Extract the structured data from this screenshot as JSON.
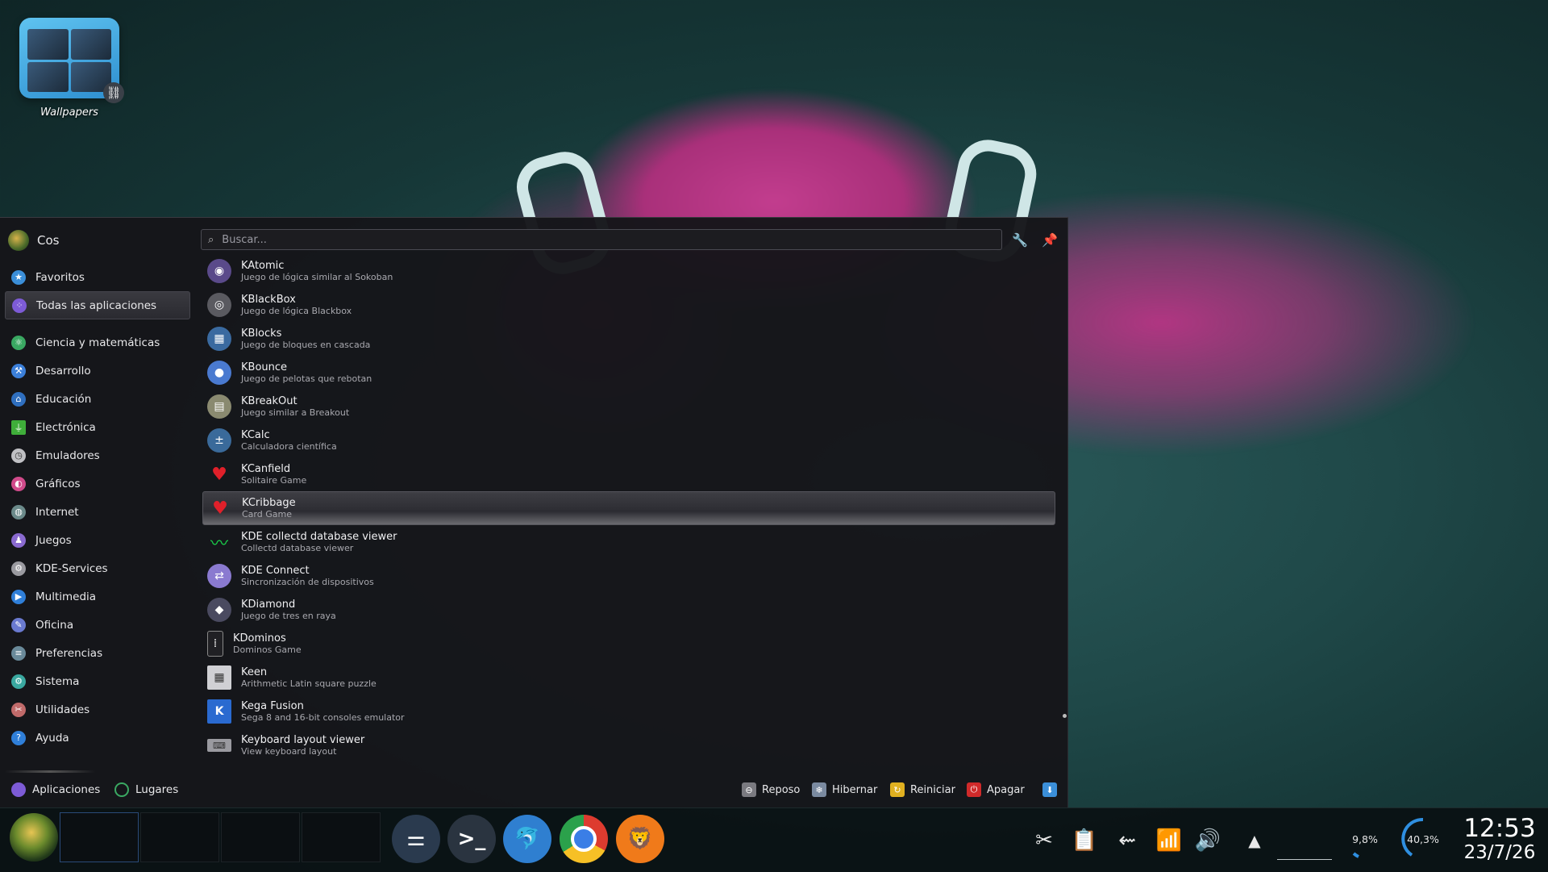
{
  "desktop": {
    "icons": [
      {
        "label": "Wallpapers",
        "icon": "folder-link-icon"
      }
    ]
  },
  "launcher": {
    "user": {
      "name": "Cos"
    },
    "search": {
      "placeholder": "Buscar..."
    },
    "categories": [
      {
        "label": "Favoritos",
        "icon": "star-icon",
        "color": "#3b8fd9"
      },
      {
        "label": "Todas las aplicaciones",
        "icon": "apps-icon",
        "color": "#7d5bd6",
        "selected": true
      },
      {
        "label": "Ciencia y matemáticas",
        "icon": "science-icon",
        "color": "#3aa862"
      },
      {
        "label": "Desarrollo",
        "icon": "development-icon",
        "color": "#3b7fd9"
      },
      {
        "label": "Educación",
        "icon": "education-icon",
        "color": "#2f6fbf"
      },
      {
        "label": "Electrónica",
        "icon": "electronics-icon",
        "color": "#3fae3a"
      },
      {
        "label": "Emuladores",
        "icon": "emulators-icon",
        "color": "#c0c0c4"
      },
      {
        "label": "Gráficos",
        "icon": "graphics-icon",
        "color": "#d04a8a"
      },
      {
        "label": "Internet",
        "icon": "internet-icon",
        "color": "#6b8a8a"
      },
      {
        "label": "Juegos",
        "icon": "games-icon",
        "color": "#8a6ad0"
      },
      {
        "label": "KDE-Services",
        "icon": "gear-icon",
        "color": "#9a9aa0"
      },
      {
        "label": "Multimedia",
        "icon": "multimedia-icon",
        "color": "#2f7fd9"
      },
      {
        "label": "Oficina",
        "icon": "office-icon",
        "color": "#6a7ad0"
      },
      {
        "label": "Preferencias",
        "icon": "preferences-icon",
        "color": "#6a8a9a"
      },
      {
        "label": "Sistema",
        "icon": "system-icon",
        "color": "#3aa8a0"
      },
      {
        "label": "Utilidades",
        "icon": "utilities-icon",
        "color": "#c06a6a"
      },
      {
        "label": "Ayuda",
        "icon": "help-icon",
        "color": "#2f7fd9"
      }
    ],
    "apps": [
      {
        "title": "KAtomic",
        "desc": "Juego de lógica similar al Sokoban",
        "icon": "katomic-icon",
        "color": "#5a4a8a"
      },
      {
        "title": "KBlackBox",
        "desc": "Juego de lógica Blackbox",
        "icon": "kblackbox-icon",
        "color": "#5a5a60"
      },
      {
        "title": "KBlocks",
        "desc": "Juego de bloques en cascada",
        "icon": "kblocks-icon",
        "color": "#3a6aa0"
      },
      {
        "title": "KBounce",
        "desc": "Juego de pelotas que rebotan",
        "icon": "kbounce-icon",
        "color": "#4a7ad0"
      },
      {
        "title": "KBreakOut",
        "desc": "Juego similar a Breakout",
        "icon": "kbreakout-icon",
        "color": "#8a8a70"
      },
      {
        "title": "KCalc",
        "desc": "Calculadora científica",
        "icon": "kcalc-icon",
        "color": "#3a6a9a"
      },
      {
        "title": "KCanfield",
        "desc": "Solitaire Game",
        "icon": "cards-icon",
        "color": "#c0202a"
      },
      {
        "title": "KCribbage",
        "desc": "Card Game",
        "icon": "cards-icon",
        "color": "#c0202a",
        "selected": true
      },
      {
        "title": "KDE collectd database viewer",
        "desc": "Collectd database viewer",
        "icon": "graph-icon",
        "color": "#1aa84a"
      },
      {
        "title": "KDE Connect",
        "desc": "Sincronización de dispositivos",
        "icon": "kdeconnect-icon",
        "color": "#8a7ad0"
      },
      {
        "title": "KDiamond",
        "desc": "Juego de tres en raya",
        "icon": "kdiamond-icon",
        "color": "#4a4a60"
      },
      {
        "title": "KDominos",
        "desc": "Dominos Game",
        "icon": "domino-icon",
        "color": "#202024"
      },
      {
        "title": "Keen",
        "desc": "Arithmetic Latin square puzzle",
        "icon": "keen-icon",
        "color": "#d0d0d4"
      },
      {
        "title": "Kega Fusion",
        "desc": "Sega 8 and 16-bit consoles emulator",
        "icon": "kega-icon",
        "color": "#2a6ad0"
      },
      {
        "title": "Keyboard layout viewer",
        "desc": "View keyboard layout",
        "icon": "keyboard-icon",
        "color": "#9a9aa0"
      }
    ],
    "tabs": [
      {
        "label": "Aplicaciones",
        "icon": "apps-icon"
      },
      {
        "label": "Lugares",
        "icon": "places-icon"
      }
    ],
    "power": [
      {
        "label": "Reposo",
        "icon": "sleep-icon",
        "color": "#7a7a80"
      },
      {
        "label": "Hibernar",
        "icon": "hibernate-icon",
        "color": "#7a8aa0"
      },
      {
        "label": "Reiniciar",
        "icon": "restart-icon",
        "color": "#e0b020"
      },
      {
        "label": "Apagar",
        "icon": "shutdown-icon",
        "color": "#d02a2a"
      }
    ]
  },
  "taskbar": {
    "dock": [
      {
        "name": "system-settings",
        "icon": "settings-icon",
        "color": "#2a3a4e"
      },
      {
        "name": "konsole",
        "icon": "terminal-icon",
        "color": "#2a3440"
      },
      {
        "name": "dolphin",
        "icon": "dolphin-icon",
        "color": "#2f7fd0"
      },
      {
        "name": "chrome",
        "icon": "chrome-icon",
        "color": "#dd3b2f"
      },
      {
        "name": "brave",
        "icon": "brave-icon",
        "color": "#f07a1a"
      }
    ],
    "gauges": [
      {
        "value": "9,8%"
      },
      {
        "value": "40,3%"
      }
    ],
    "clock": {
      "time": "12:53",
      "date": "23/7/26"
    }
  }
}
